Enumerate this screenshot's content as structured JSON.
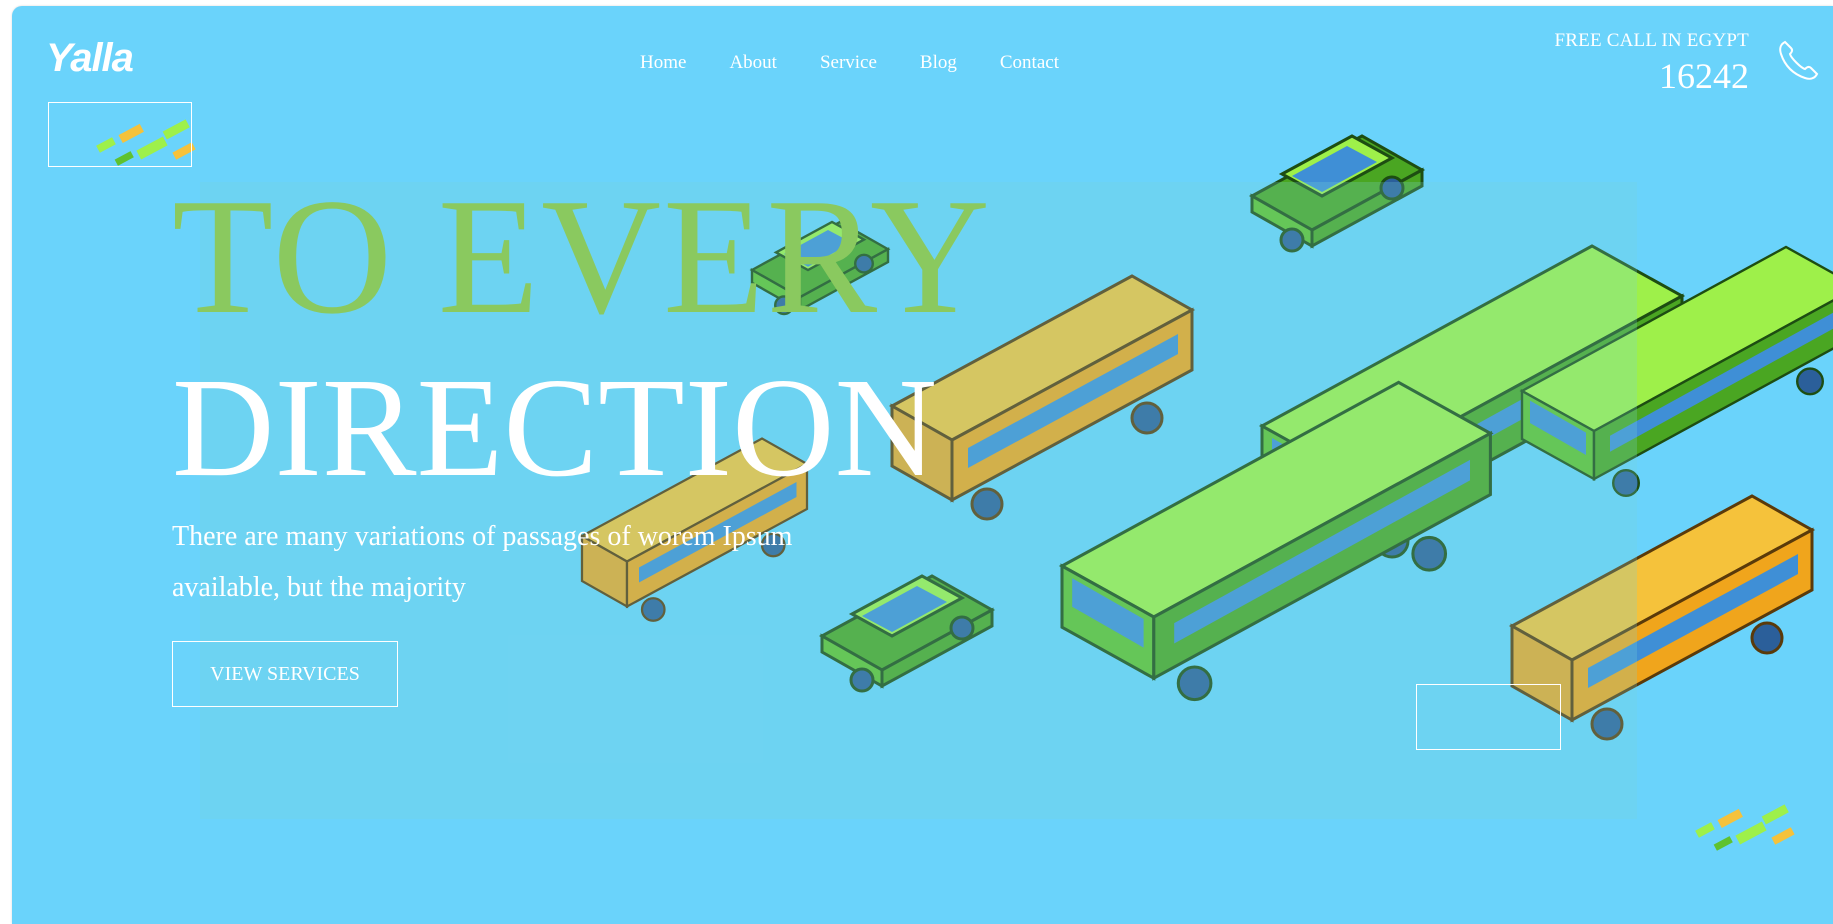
{
  "brand": {
    "logo_text": "Yalla"
  },
  "nav": {
    "items": [
      {
        "label": "Home"
      },
      {
        "label": "About"
      },
      {
        "label": "Service"
      },
      {
        "label": "Blog"
      },
      {
        "label": "Contact"
      }
    ]
  },
  "call": {
    "label": "FREE CALL IN EGYPT",
    "number": "16242",
    "icon": "phone-icon"
  },
  "hero": {
    "headline_line1": "TO EVERY",
    "headline_line2": "DIRECTION",
    "description": "There are many variations of passages of worem Ipsum available, but the majority",
    "cta_label": "VIEW SERVICES",
    "headline_accent_color": "#8ac95f"
  },
  "theme": {
    "background": "#6ad3fb",
    "vehicle_green": "#8fe23e",
    "vehicle_yellow": "#f5c23b",
    "window_blue": "#3f8fd6"
  }
}
